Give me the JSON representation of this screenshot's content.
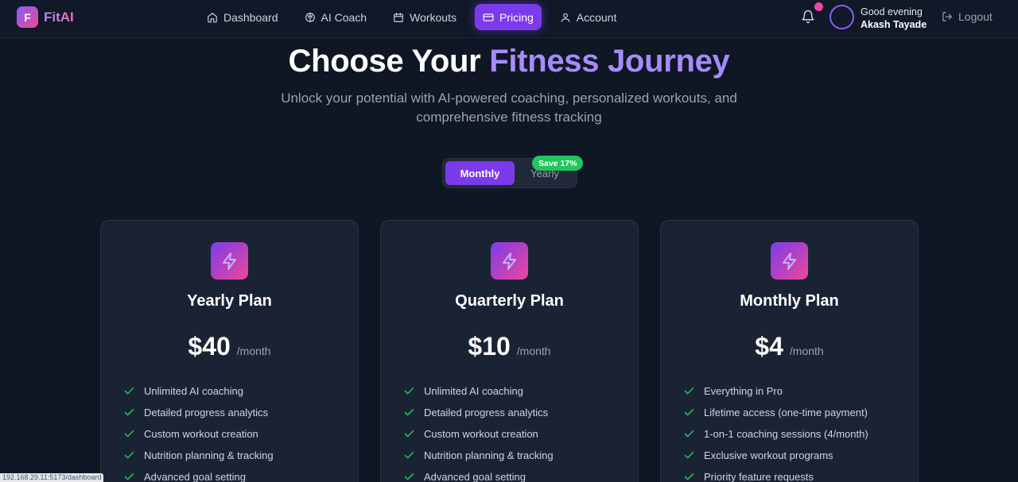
{
  "brand": {
    "logo_letter": "F",
    "name": "FitAI"
  },
  "nav": {
    "items": [
      {
        "label": "Dashboard",
        "icon": "home-icon"
      },
      {
        "label": "AI Coach",
        "icon": "brain-icon"
      },
      {
        "label": "Workouts",
        "icon": "calendar-icon"
      },
      {
        "label": "Pricing",
        "icon": "credit-card-icon",
        "active": true
      },
      {
        "label": "Account",
        "icon": "user-icon"
      }
    ]
  },
  "user": {
    "greeting": "Good evening",
    "name": "Akash Tayade"
  },
  "logout_label": "Logout",
  "hero": {
    "title_part1": "Choose Your ",
    "title_accent": "Fitness Journey",
    "subtitle": "Unlock your potential with AI-powered coaching, personalized workouts, and comprehensive fitness tracking"
  },
  "billing": {
    "monthly": "Monthly",
    "yearly": "Yearly",
    "save_badge": "Save 17%",
    "selected": "Monthly"
  },
  "plans": [
    {
      "title": "Yearly Plan",
      "price": "$40",
      "period": "/month",
      "features": [
        "Unlimited AI coaching",
        "Detailed progress analytics",
        "Custom workout creation",
        "Nutrition planning & tracking",
        "Advanced goal setting"
      ]
    },
    {
      "title": "Quarterly Plan",
      "price": "$10",
      "period": "/month",
      "features": [
        "Unlimited AI coaching",
        "Detailed progress analytics",
        "Custom workout creation",
        "Nutrition planning & tracking",
        "Advanced goal setting"
      ]
    },
    {
      "title": "Monthly Plan",
      "price": "$4",
      "period": "/month",
      "features": [
        "Everything in Pro",
        "Lifetime access (one-time payment)",
        "1-on-1 coaching sessions (4/month)",
        "Exclusive workout programs",
        "Priority feature requests"
      ]
    }
  ],
  "status_url": "192.168.29.11:5173/dashboard",
  "colors": {
    "accent": "#7c3aed",
    "accent_light": "#a78bfa",
    "pink": "#ec4899",
    "check": "#22c55e",
    "bg": "#0f1624"
  }
}
